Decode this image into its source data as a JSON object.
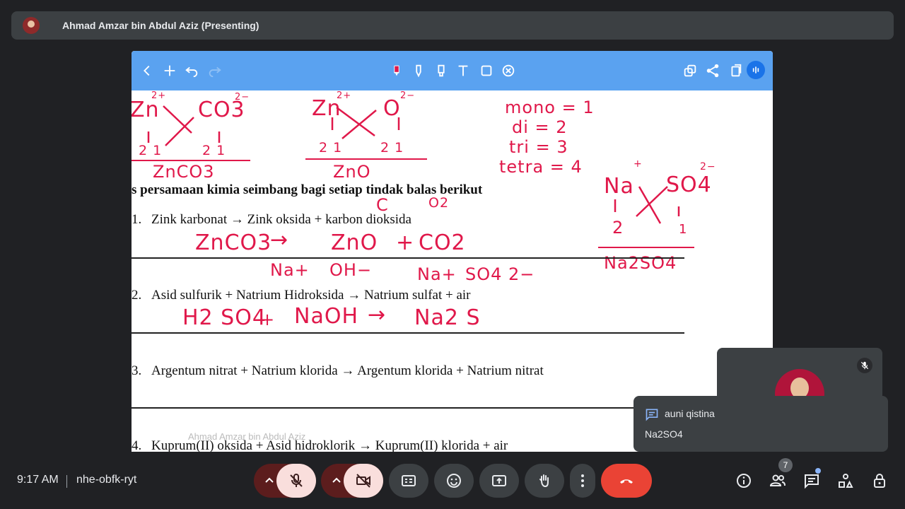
{
  "presenter": {
    "name": "Ahmad Amzar bin Abdul Aziz (Presenting)"
  },
  "whiteboard": {
    "toolbar": {
      "tools": [
        "back-icon",
        "add-icon",
        "undo-icon",
        "redo-icon",
        "pen-red-icon",
        "marker-icon",
        "highlighter-icon",
        "text-icon",
        "shape-icon",
        "eraser-icon",
        "layers-icon",
        "share-icon",
        "copy-icon",
        "live-icon"
      ]
    },
    "accent_color": "#5aa2f0",
    "ink_color": "#e0184a",
    "heading": "s persamaan kimia seimbang bagi setiap tindak balas berikut",
    "questions": [
      {
        "number": "1.",
        "text": "Zink karbonat → Zink oksida + karbon dioksida"
      },
      {
        "number": "2.",
        "text": "Asid sulfurik + Natrium Hidroksida → Natrium sulfat + air"
      },
      {
        "number": "3.",
        "text": "Argentum nitrat + Natrium klorida → Argentum klorida + Natrium nitrat"
      },
      {
        "number": "4.",
        "text": "Kuprum(II) oksida + Asid hidroklorik → Kuprum(II) klorida + air"
      }
    ],
    "handwriting": {
      "zn_charge": "Zn",
      "zn_sup": "2+",
      "co3": "CO3",
      "co3_sup": "2−",
      "zn2": "Zn",
      "zn2_sup": "2+",
      "o": "O",
      "o_sup": "2−",
      "cross1_left": "2 1",
      "cross1_right": "2 1",
      "cross2_left": "2 1",
      "cross2_right": "2 1",
      "znco3": "ZnCO3",
      "zno_result": "ZnO",
      "prefixes": [
        "mono = 1",
        "di = 2",
        "tri = 3",
        "tetra = 4"
      ],
      "c_label": "C",
      "o2_label": "O2",
      "eq1": [
        "ZnCO3",
        "→",
        "ZnO",
        "+",
        "CO2"
      ],
      "ions": [
        "Na+",
        "OH−",
        "Na+",
        "SO4 2−"
      ],
      "eq2": [
        "H2 SO4",
        "+",
        "NaOH",
        "→",
        "Na2 S"
      ],
      "na_plus": "Na",
      "na_sup": "+",
      "so4": "SO4",
      "so4_sup": "2−",
      "na_down": "2",
      "so4_down": "1",
      "na2so4": "Na2SO4"
    },
    "cursor_label": "Ahmad Amzar bin Abdul Aziz"
  },
  "chat": {
    "sender": "auni qistina",
    "message": "Na2SO4"
  },
  "footer": {
    "time": "9:17 AM",
    "meeting_code": "nhe-obfk-ryt",
    "participants_count": "7"
  }
}
